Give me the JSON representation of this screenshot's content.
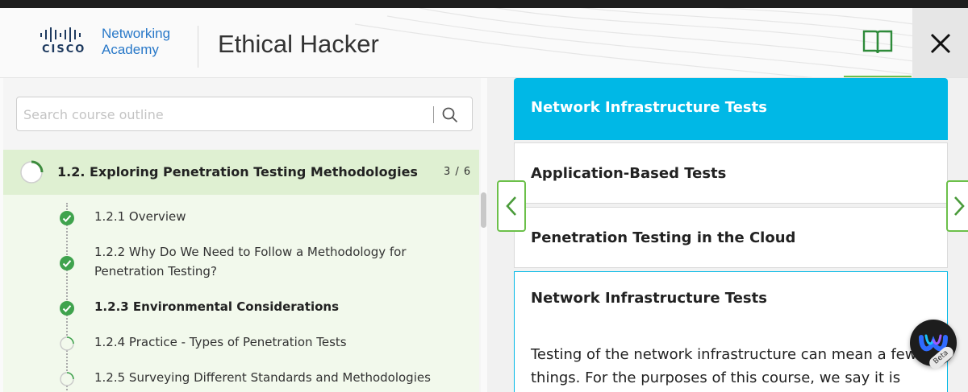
{
  "header": {
    "logo_company": "CISCO",
    "logo_line1": "Networking",
    "logo_line2": "Academy",
    "course_title": "Ethical Hacker",
    "book_icon": "book-icon",
    "close_icon": "close-icon"
  },
  "outline": {
    "search": {
      "placeholder": "Search course outline",
      "value": ""
    },
    "module": {
      "title": "1.2. Exploring Penetration Testing Methodologies",
      "progress": "3 / 6"
    },
    "items": [
      {
        "label": "1.2.1 Overview",
        "status": "complete"
      },
      {
        "label": "1.2.2 Why Do We Need to Follow a Methodology for Penetration Testing?",
        "status": "complete"
      },
      {
        "label": "1.2.3 Environmental Considerations",
        "status": "complete",
        "current": true
      },
      {
        "label": "1.2.4 Practice - Types of Penetration Tests",
        "status": "not-started"
      },
      {
        "label": "1.2.5 Surveying Different Standards and Methodologies",
        "status": "not-started"
      }
    ]
  },
  "content": {
    "tabs": [
      {
        "label": "Network Infrastructure Tests",
        "active": true
      },
      {
        "label": "Application-Based Tests",
        "active": false
      },
      {
        "label": "Penetration Testing in the Cloud",
        "active": false
      }
    ],
    "panel": {
      "title": "Network Infrastructure Tests",
      "body_line1": "Testing of the network infrastructure can mean a few",
      "body_line2": "things. For the purposes of this course, we say it is"
    }
  },
  "assistant": {
    "badge": "Beta"
  },
  "colors": {
    "accent_green": "#6cc04a",
    "tab_blue": "#00b8e6",
    "module_bg": "#dff0d2"
  }
}
